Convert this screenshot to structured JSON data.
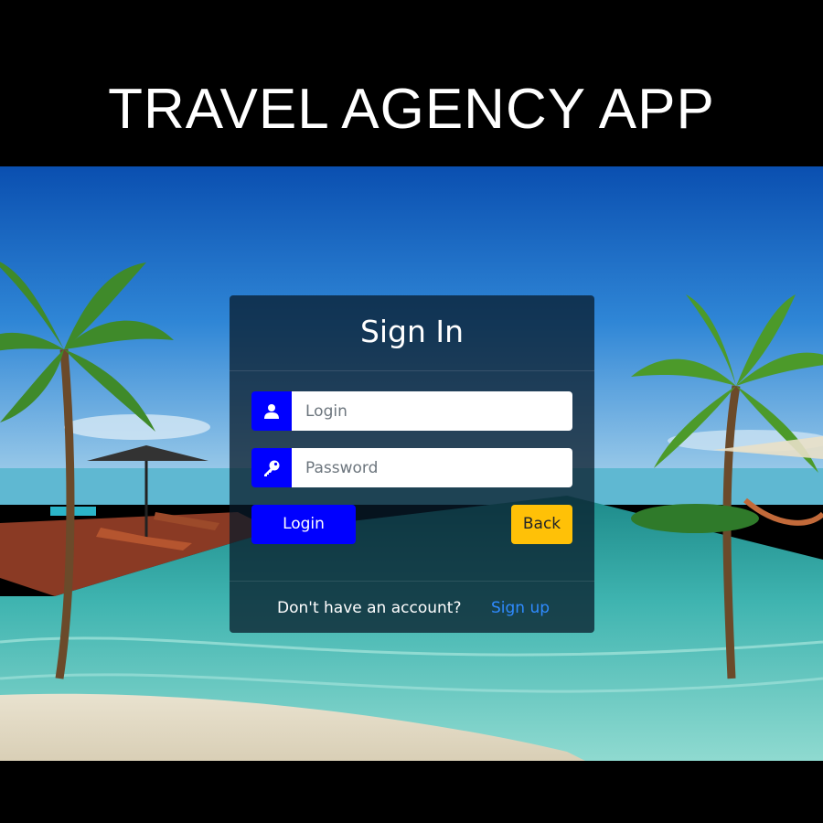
{
  "app_title": "TRAVEL AGENCY APP",
  "card": {
    "title": "Sign In",
    "login_placeholder": "Login",
    "login_value": "",
    "password_placeholder": "Password",
    "password_value": "",
    "login_button": "Login",
    "back_button": "Back",
    "footer_text": "Don't have an account?",
    "signup_link": "Sign up"
  },
  "icons": {
    "login_field": "user-icon",
    "password_field": "key-icon"
  },
  "colors": {
    "page_background": "#000000",
    "primary_button": "#0000ff",
    "back_button": "#ffc107",
    "link": "#2f8bff",
    "card_background": "rgba(8, 26, 40, 0.74)"
  }
}
